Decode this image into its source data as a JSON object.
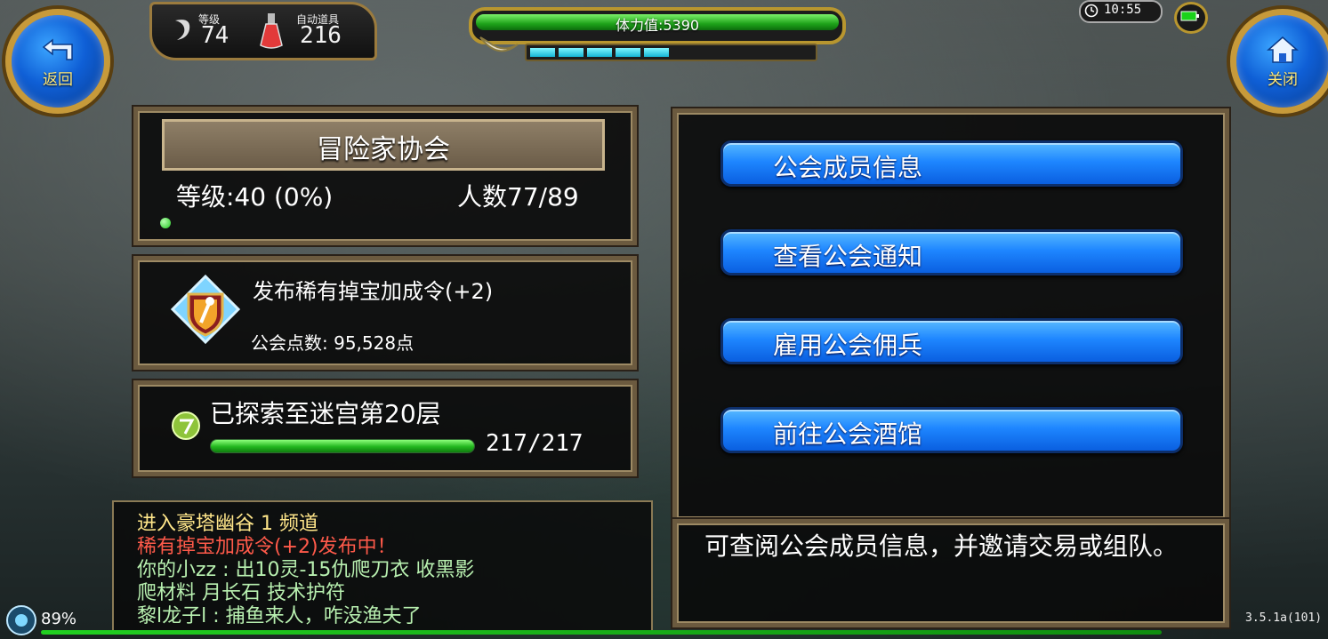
{
  "hud": {
    "back_label": "返回",
    "close_label": "关闭",
    "level_label": "等级",
    "level_value": "74",
    "auto_items_label": "自动道具",
    "auto_items_value": "216",
    "stamina_text": "体力值:5390",
    "clock_text": "10:55",
    "battery_text": "89%",
    "version_text": "3.5.1a(101)",
    "stamina_segments_filled": 5,
    "stamina_segments_total": 10
  },
  "guild": {
    "name": "冒险家协会",
    "level_text": "等级:40 (0%)",
    "members_text": "人数77/89",
    "boost_title": "发布稀有掉宝加成令(+2)",
    "points_text": "公会点数: 95,528点",
    "explore_text": "已探索至迷宫第20层",
    "explore_count": "217/217",
    "explore_progress": 1.0
  },
  "menu": [
    {
      "label": "公会成员信息"
    },
    {
      "label": "查看公会通知"
    },
    {
      "label": "雇用公会佣兵"
    },
    {
      "label": "前往公会酒馆"
    }
  ],
  "description": "可查阅公会成员信息，并邀请交易或组队。",
  "chat": [
    {
      "text": "进入豪塔幽谷 1 频道",
      "color": "#ffe68a"
    },
    {
      "text": "稀有掉宝加成令(+2)发布中！",
      "color": "#ff5a4a"
    },
    {
      "text": "你的小zz       : 出10灵-15仇爬刀衣 收黑影",
      "color": "#b8f0b0"
    },
    {
      "text": "爬材料 月长石 技术护符",
      "color": "#b8f0b0"
    },
    {
      "text": "黎l龙子l       : 捕鱼来人，咋没渔夫了",
      "color": "#b8f0b0"
    }
  ],
  "colors": {
    "accent_blue": "#1e86ff",
    "gold": "#c79a3a",
    "stamina_green": "#1ea31a"
  }
}
